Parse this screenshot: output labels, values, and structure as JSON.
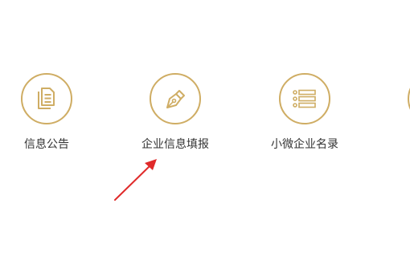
{
  "theme": {
    "accent_color": "#cfad64",
    "label_color": "#333333",
    "annotation_arrow_color": "#e02a2a"
  },
  "nav": {
    "items": [
      {
        "label": "信息公告",
        "icon": "document-icon"
      },
      {
        "label": "企业信息填报",
        "icon": "pen-nib-icon"
      },
      {
        "label": "小微企业名录",
        "icon": "list-icon"
      },
      {
        "label": "",
        "icon": "partially-visible-icon"
      }
    ]
  }
}
